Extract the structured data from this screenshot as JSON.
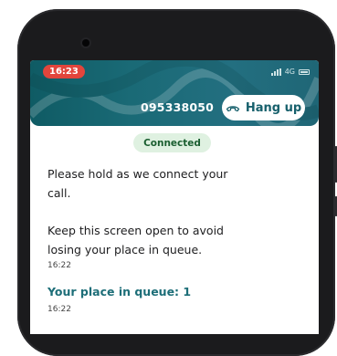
{
  "status_bar": {
    "time": "16:23",
    "network": "4G"
  },
  "call": {
    "phone_number": "095338050",
    "hangup_label": "Hang up"
  },
  "badge": {
    "label": "Connected"
  },
  "messages": [
    {
      "line1": "Please hold as we connect your",
      "line2": "call."
    },
    {
      "line1": "Keep this screen open to avoid",
      "line2": "losing your place in queue.",
      "timestamp": "16:22"
    }
  ],
  "queue": {
    "label": "Your place in queue: 1",
    "timestamp": "16:22"
  },
  "colors": {
    "header": "#1a6a76",
    "status_time_bg": "#e2453c",
    "accent": "#17606c",
    "connected_bg": "#dff1e1",
    "connected_text": "#1a5e30"
  },
  "icons": {
    "hangup": "phone-hangup-icon"
  }
}
